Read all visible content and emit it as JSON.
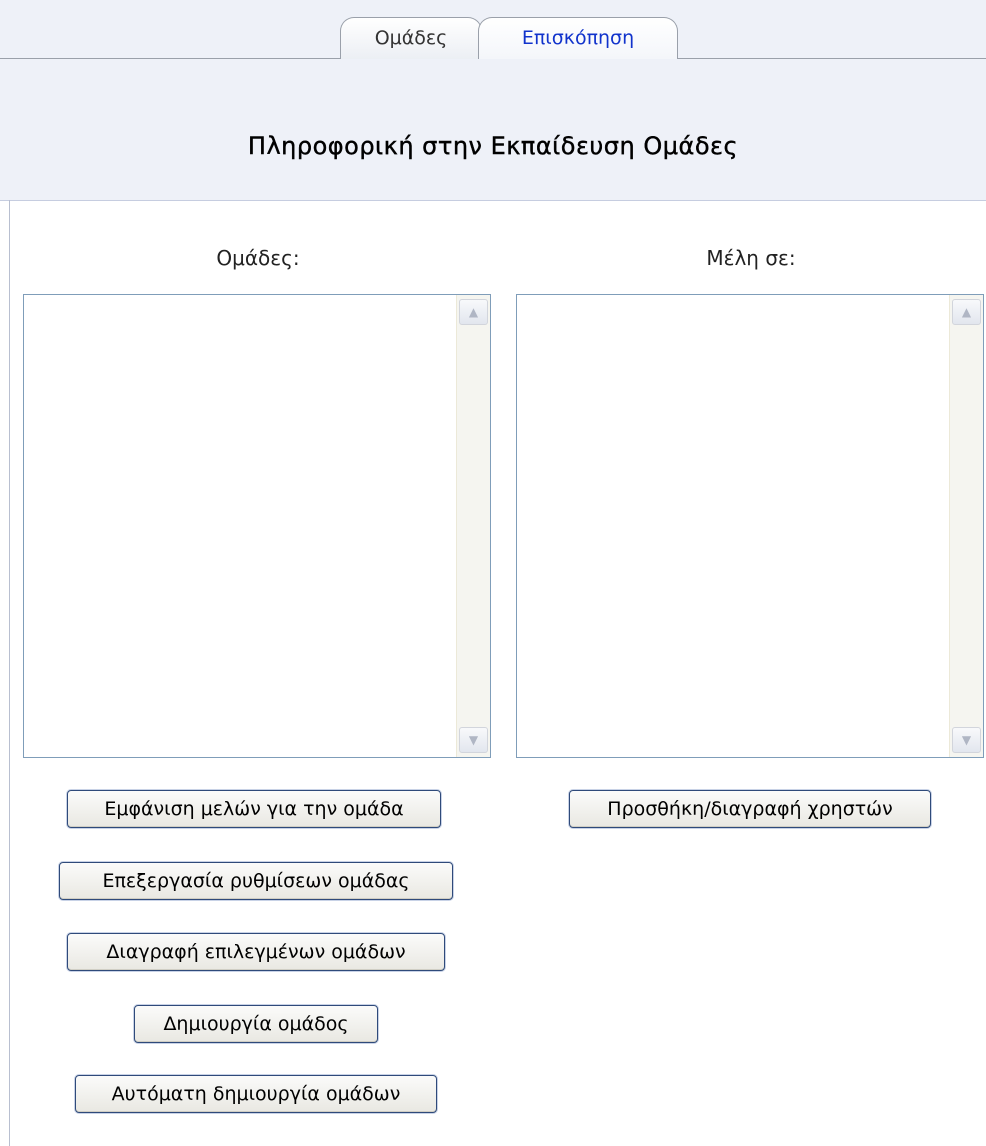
{
  "tabs": [
    {
      "label": "Ομάδες"
    },
    {
      "label": "Επισκόπηση"
    }
  ],
  "page_title": "Πληροφορική στην Εκπαίδευση Ομάδες",
  "groups_panel": {
    "label": "Ομάδες:",
    "items": []
  },
  "members_panel": {
    "label": "Μέλη σε:",
    "items": []
  },
  "buttons": {
    "show_members": "Εμφάνιση μελών για την ομάδα",
    "edit_settings": "Επεξεργασία ρυθμίσεων ομάδας",
    "delete_selected": "Διαγραφή επιλεγμένων ομάδων",
    "create_group": "Δημιουργία ομάδος",
    "auto_create": "Αυτόματη δημιουργία ομάδων",
    "add_remove_users": "Προσθήκη/διαγραφή χρηστών"
  },
  "icons": {
    "scroll_up": "chevron-up-icon",
    "scroll_down": "chevron-down-icon"
  },
  "colors": {
    "header_band": "#eef1f8",
    "active_tab_text": "#1133cc",
    "listbox_border": "#7f9db9",
    "button_border": "#2f4a7a"
  }
}
